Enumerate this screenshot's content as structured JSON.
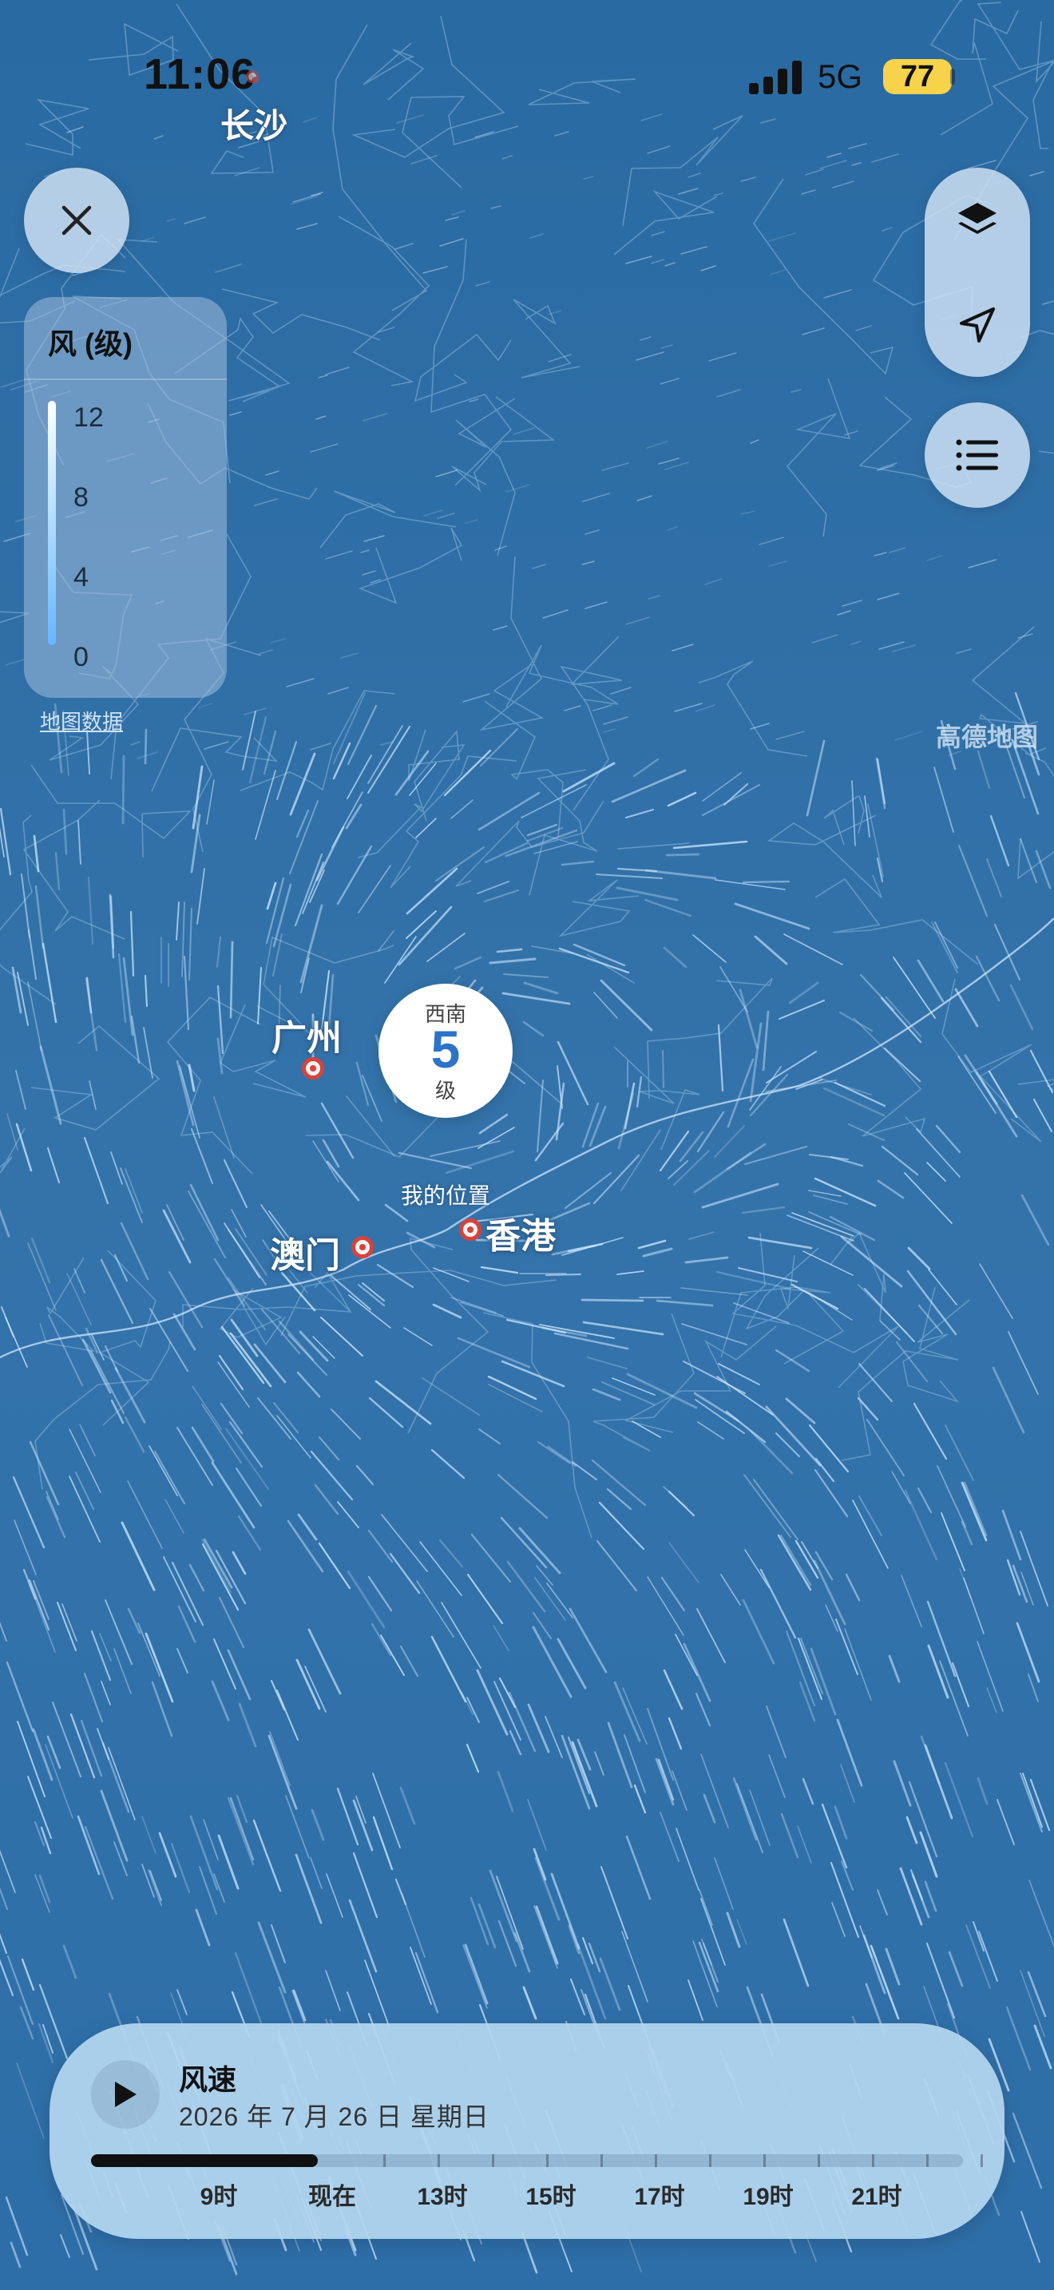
{
  "status": {
    "time": "11:06",
    "network": "5G",
    "battery": "77"
  },
  "map": {
    "cities": {
      "changsha": "长沙",
      "guangzhou": "广州",
      "macau": "澳门",
      "hongkong": "香港"
    },
    "my_location": "我的位置",
    "attribution": "高德地图",
    "map_data_link": "地图数据"
  },
  "legend": {
    "title": "风 (级)",
    "ticks": [
      "12",
      "8",
      "4",
      "0"
    ]
  },
  "wind_marker": {
    "direction": "西南",
    "level": "5",
    "unit": "级"
  },
  "controls": {
    "close_icon": "close-icon",
    "layers_icon": "layers-icon",
    "location_icon": "location-arrow-icon",
    "list_icon": "list-icon"
  },
  "timeline": {
    "title": "风速",
    "date": "2026 年 7 月 26 日 星期日",
    "progress": 0.26,
    "labels": [
      "9时",
      "现在",
      "13时",
      "15时",
      "17时",
      "19时",
      "21时"
    ]
  },
  "colors": {
    "sea": "#2f6fa6",
    "wind_streak": "#cfe9ff",
    "accent_blue": "#2d73c8",
    "city_marker": "#d7433a",
    "battery": "#f6d34a"
  }
}
